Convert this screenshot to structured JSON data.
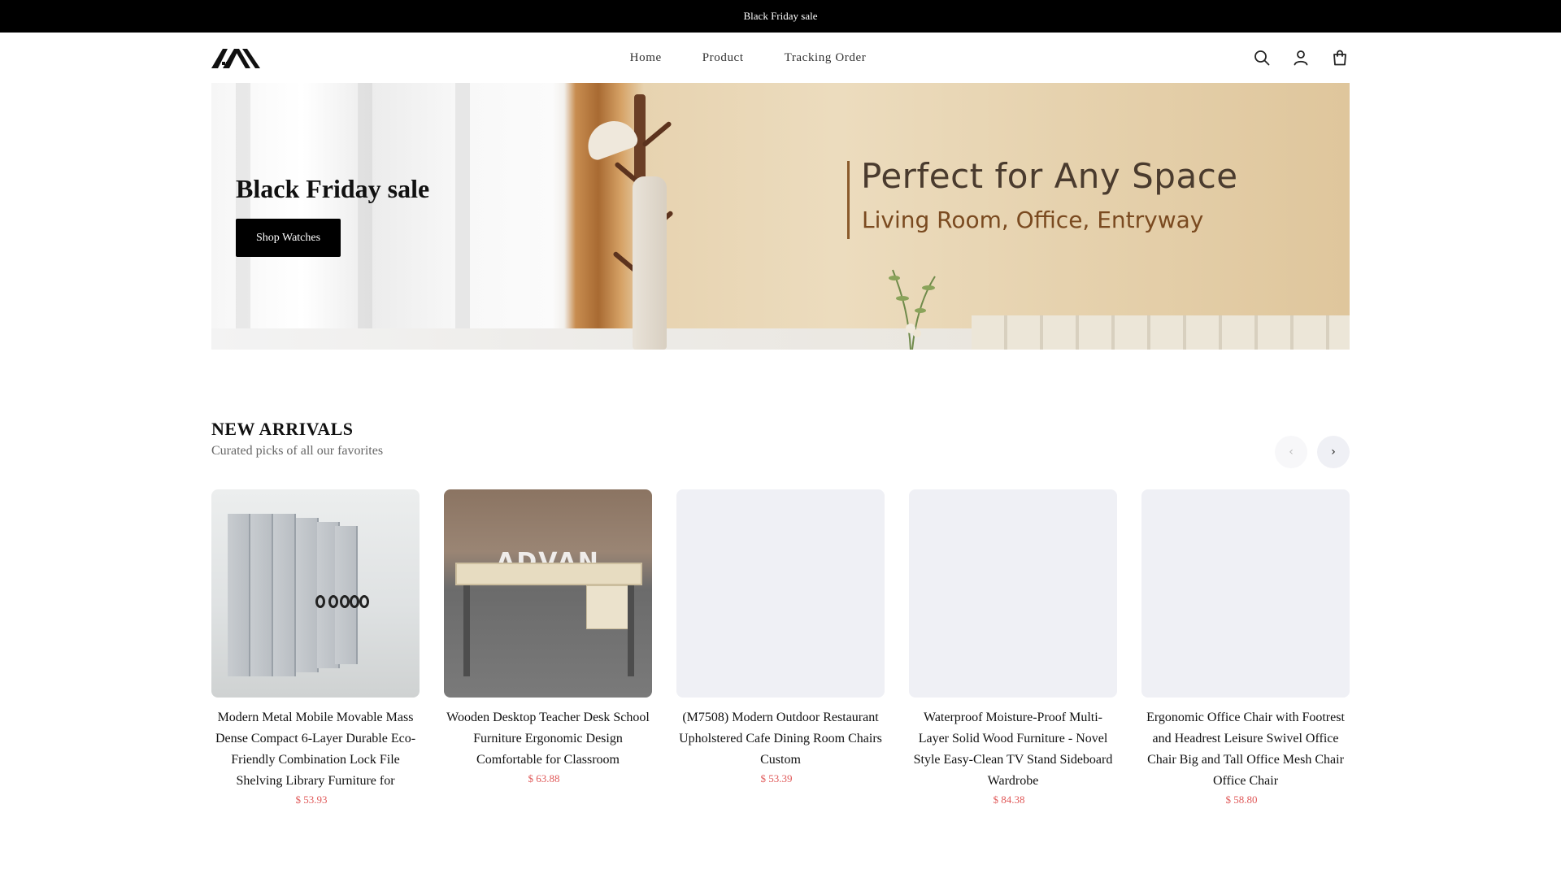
{
  "announcement": {
    "text": "Black Friday sale"
  },
  "header": {
    "logo_icon": "brand-logo-mountains",
    "nav": [
      {
        "label": "Home"
      },
      {
        "label": "Product"
      },
      {
        "label": "Tracking Order"
      }
    ],
    "icons": [
      "search-icon",
      "account-icon",
      "cart-bag-icon"
    ]
  },
  "hero": {
    "title": "Black Friday sale",
    "button_label": "Shop Watches",
    "image_text_line1": "Perfect for Any Space",
    "image_text_line2": "Living Room, Office, Entryway"
  },
  "new_arrivals": {
    "title": "NEW ARRIVALS",
    "subtitle": "Curated picks of all our favorites",
    "prev_icon": "chevron-left-icon",
    "next_icon": "chevron-right-icon",
    "products": [
      {
        "name": "Modern Metal Mobile Movable Mass Dense Compact 6-Layer Durable Eco-Friendly Combination Lock File Shelving Library Furniture for",
        "price": "$ 53.93"
      },
      {
        "name": "Wooden Desktop Teacher Desk School Furniture Ergonomic Design Comfortable for Classroom",
        "price": "$ 63.88",
        "image_watermark": "ADVAN"
      },
      {
        "name": "(M7508) Modern Outdoor Restaurant Upholstered Cafe Dining Room Chairs Custom",
        "price": "$ 53.39"
      },
      {
        "name": "Waterproof Moisture-Proof Multi-Layer Solid Wood Furniture - Novel Style Easy-Clean TV Stand Sideboard Wardrobe",
        "price": "$ 84.38"
      },
      {
        "name": "Ergonomic Office Chair with Footrest and Headrest Leisure Swivel Office Chair Big and Tall Office Mesh Chair Office Chair",
        "price": "$ 58.80"
      }
    ]
  },
  "colors": {
    "announcement_bg": "#000000",
    "button_bg": "#000000",
    "price": "#e05a5a",
    "placeholder": "#eff0f5"
  }
}
